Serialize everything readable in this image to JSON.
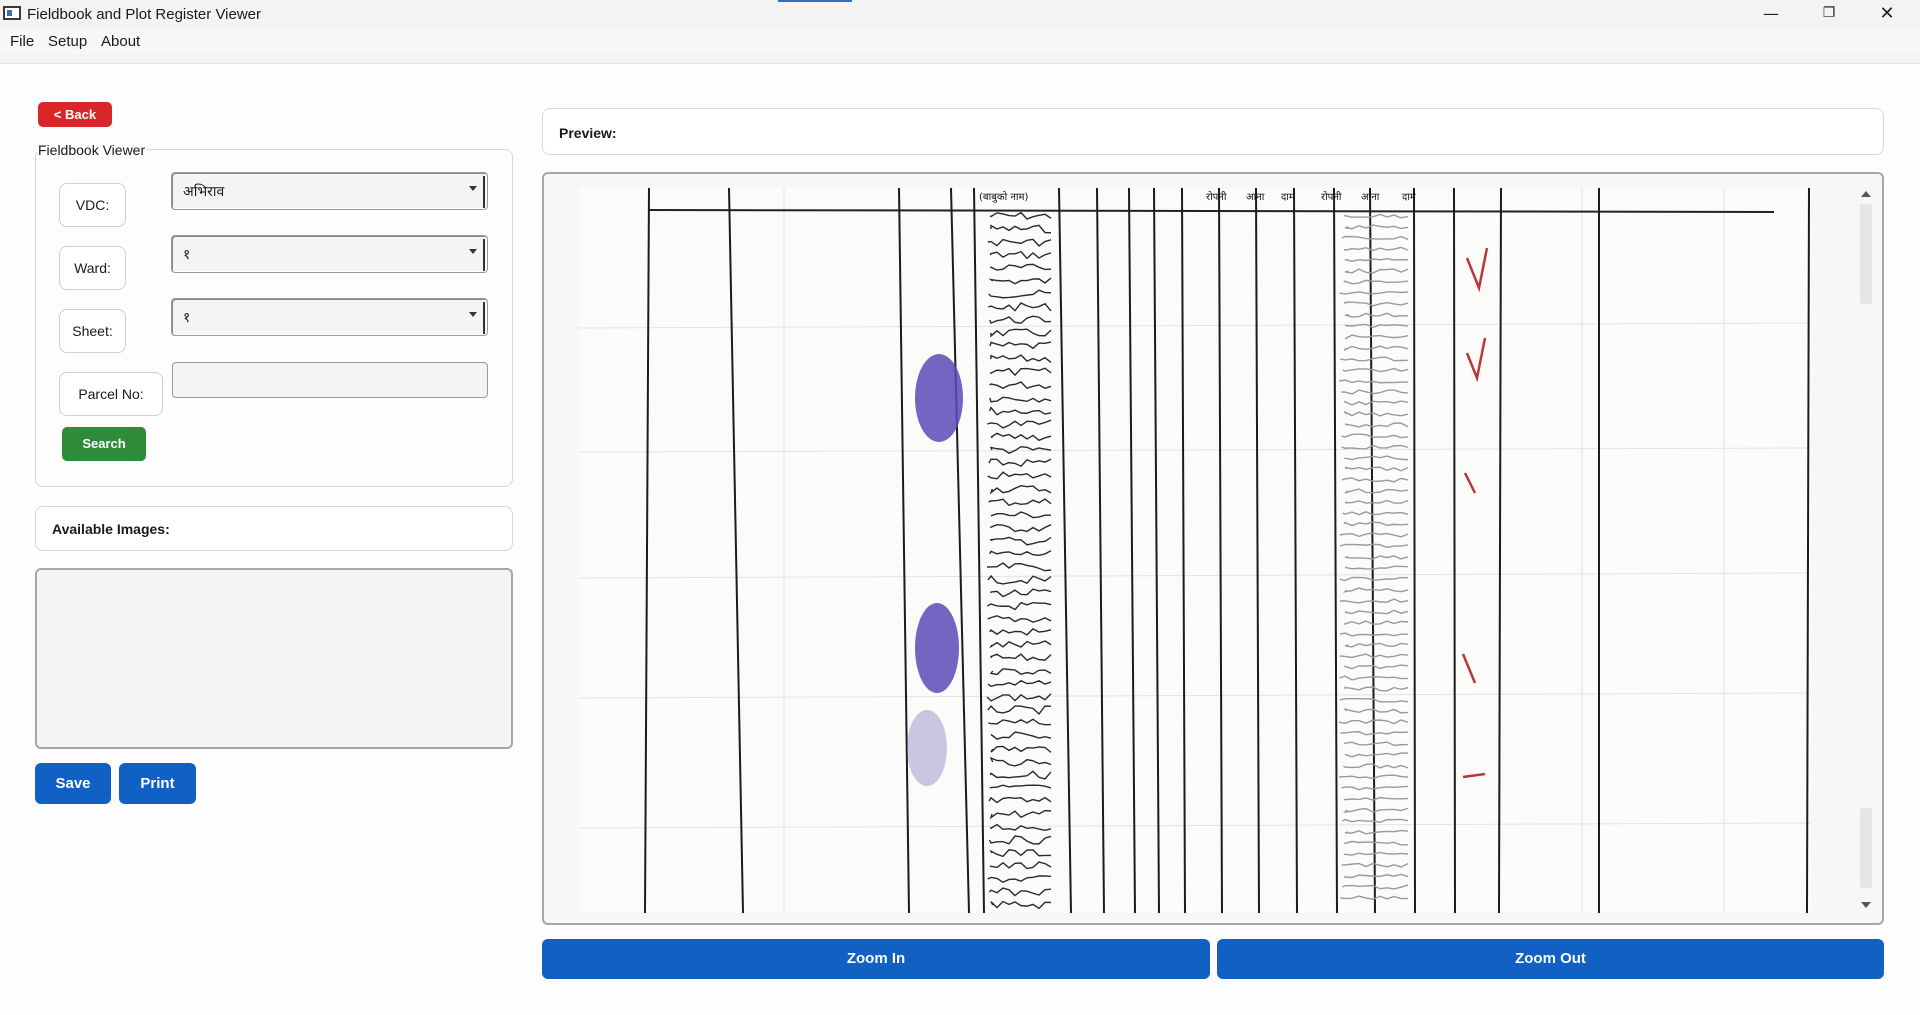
{
  "window": {
    "title": "Fieldbook and Plot Register Viewer",
    "minimize_glyph": "—",
    "maximize_glyph": "❐",
    "close_glyph": "✕"
  },
  "menu": [
    "File",
    "Setup",
    "About"
  ],
  "back_label": "< Back",
  "fieldbook": {
    "group_title": "Fieldbook Viewer",
    "vdc_label": "VDC:",
    "vdc_value": "अभिराव",
    "ward_label": "Ward:",
    "ward_value": "१",
    "sheet_label": "Sheet:",
    "sheet_value": "१",
    "parcel_label": "Parcel No:",
    "parcel_value": "",
    "search_label": "Search"
  },
  "available_images_label": "Available Images:",
  "available_images": [],
  "save_label": "Save",
  "print_label": "Print",
  "preview_label": "Preview:",
  "scan_header": [
    "(बाबुको नाम)",
    "रोपनी",
    "आना",
    "दाम",
    "रोपनी",
    "आना",
    "दाम"
  ],
  "zoom_in_label": "Zoom In",
  "zoom_out_label": "Zoom Out",
  "colors": {
    "back": "#d9262b",
    "search": "#2e8b3a",
    "primary": "#1160c4",
    "fingerprint": "#5b4bb8"
  }
}
